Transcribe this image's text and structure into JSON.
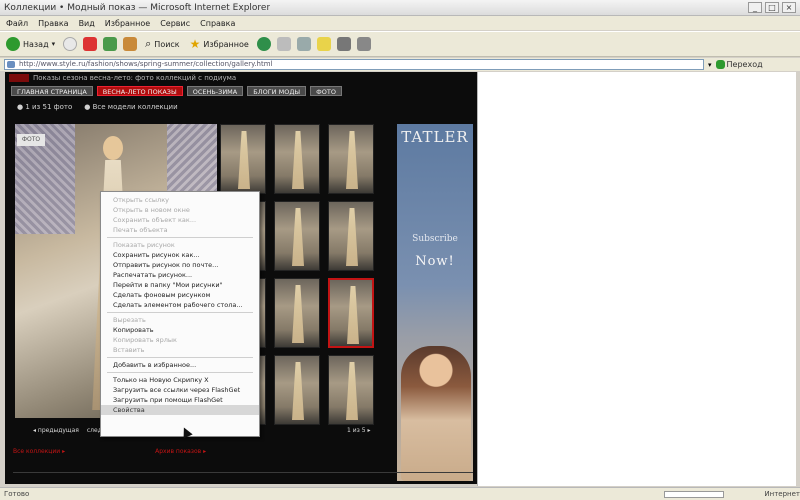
{
  "window": {
    "title": "Коллекции • Модный показ — Microsoft Internet Explorer",
    "controls": [
      "_",
      "□",
      "×"
    ]
  },
  "menu": [
    "Файл",
    "Правка",
    "Вид",
    "Избранное",
    "Сервис",
    "Справка"
  ],
  "toolbar": {
    "back_label": "Назад",
    "search_label": "Поиск",
    "favorites_label": "Избранное"
  },
  "address": {
    "url": "http://www.style.ru/fashion/shows/spring-summer/collection/gallery.html",
    "go_label": "Переход"
  },
  "site": {
    "header_text": "Показы сезона весна-лето: фото коллекций с подиума",
    "tabs": [
      {
        "label": "ГЛАВНАЯ СТРАНИЦА"
      },
      {
        "label": "ВЕСНА-ЛЕТО ПОКАЗЫ"
      },
      {
        "label": "ОСЕНЬ-ЗИМА"
      },
      {
        "label": "БЛОГИ МОДЫ"
      },
      {
        "label": "ФОТО"
      }
    ],
    "info": [
      "● 1 из 51 фото",
      "● Все модели коллекции"
    ],
    "main_photo_caption": "ФОТО",
    "pagination": [
      "◂ предыдущая",
      "следующая ▸"
    ],
    "pager_right": "1 из 5 ▸",
    "footer_links": [
      "Все коллекции ▸",
      "Архив показов ▸"
    ]
  },
  "ad": {
    "brand": "TATLER",
    "sub": "Subscribe",
    "now": "Now!"
  },
  "context_menu": {
    "items": [
      {
        "label": "Открыть ссылку",
        "disabled": true
      },
      {
        "label": "Открыть в новом окне",
        "disabled": true
      },
      {
        "label": "Сохранить объект как...",
        "disabled": true
      },
      {
        "label": "Печать объекта",
        "disabled": true
      },
      {
        "sep": true
      },
      {
        "label": "Показать рисунок",
        "disabled": true
      },
      {
        "label": "Сохранить рисунок как...",
        "disabled": false
      },
      {
        "label": "Отправить рисунок по почте...",
        "disabled": false
      },
      {
        "label": "Распечатать рисунок...",
        "disabled": false
      },
      {
        "label": "Перейти в папку \"Мои рисунки\"",
        "disabled": false
      },
      {
        "label": "Сделать фоновым рисунком",
        "disabled": false
      },
      {
        "label": "Сделать элементом рабочего стола...",
        "disabled": false
      },
      {
        "sep": true
      },
      {
        "label": "Вырезать",
        "disabled": true
      },
      {
        "label": "Копировать",
        "disabled": false
      },
      {
        "label": "Копировать ярлык",
        "disabled": true
      },
      {
        "label": "Вставить",
        "disabled": true
      },
      {
        "sep": true
      },
      {
        "label": "Добавить в избранное...",
        "disabled": false
      },
      {
        "sep": true
      },
      {
        "label": "Только на Новую Скрипку X",
        "disabled": false
      },
      {
        "label": "Загрузить все ссылки через FlashGet",
        "disabled": false
      },
      {
        "label": "Загрузить при помощи FlashGet",
        "disabled": false
      },
      {
        "label": "Свойства",
        "disabled": false,
        "highlight": true
      }
    ]
  },
  "status": {
    "text": "Готово",
    "zone": "Интернет"
  }
}
